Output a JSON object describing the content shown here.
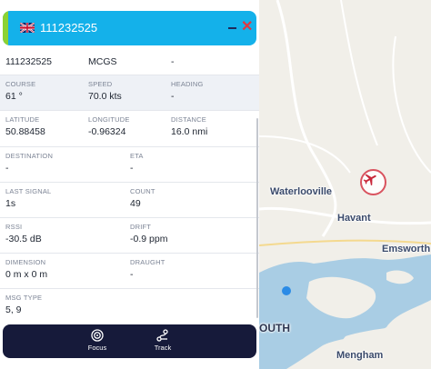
{
  "header": {
    "title": "111232525",
    "flag_icon": "uk-flag-icon",
    "minimize_icon": "minimize-icon",
    "close_icon": "close-icon",
    "close_glyph": "✕",
    "accent_color": "#14b1ea",
    "stripe_color": "#8dd233"
  },
  "identity": {
    "id": "111232525",
    "callsign": "MCGS",
    "other": "-"
  },
  "fields": {
    "course": {
      "label": "COURSE",
      "value": "61 °"
    },
    "speed": {
      "label": "SPEED",
      "value": "70.0 kts"
    },
    "heading": {
      "label": "HEADING",
      "value": "-"
    },
    "latitude": {
      "label": "LATITUDE",
      "value": "50.88458"
    },
    "longitude": {
      "label": "LONGITUDE",
      "value": "-0.96324"
    },
    "distance": {
      "label": "DISTANCE",
      "value": "16.0 nmi"
    },
    "destination": {
      "label": "DESTINATION",
      "value": "-"
    },
    "eta": {
      "label": "ETA",
      "value": "-"
    },
    "last_signal": {
      "label": "LAST SIGNAL",
      "value": "1s"
    },
    "count": {
      "label": "COUNT",
      "value": "49"
    },
    "rssi": {
      "label": "RSSI",
      "value": "-30.5 dB"
    },
    "drift": {
      "label": "DRIFT",
      "value": "-0.9 ppm"
    },
    "dimension": {
      "label": "DIMENSION",
      "value": "0 m x 0 m"
    },
    "draught": {
      "label": "DRAUGHT",
      "value": "-"
    },
    "msg_type": {
      "label": "MSG TYPE",
      "value": "5, 9"
    }
  },
  "bottom_bar": {
    "focus": {
      "label": "Focus",
      "icon": "target-icon"
    },
    "track": {
      "label": "Track",
      "icon": "route-icon"
    }
  },
  "map": {
    "places": {
      "waterlooville": "Waterlooville",
      "havant": "Havant",
      "emsworth": "Emsworth",
      "south": "OUTH",
      "mengham": "Mengham"
    },
    "aircraft_icon": "airplane-icon",
    "water_color": "#a9cde4",
    "land_color": "#f1efe9",
    "aircraft_color": "#c8283a"
  }
}
